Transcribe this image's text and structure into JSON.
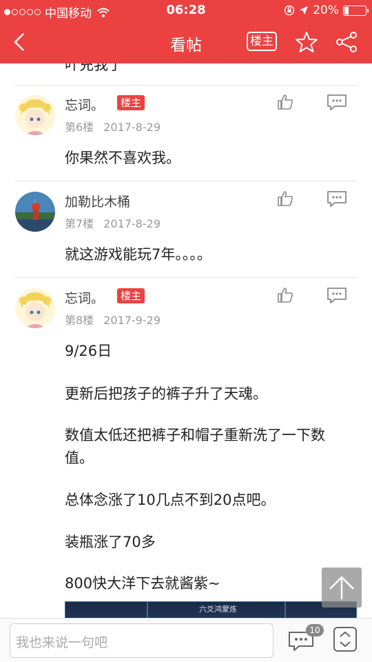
{
  "status_bar": {
    "carrier": "中国移动",
    "time": "06:28",
    "battery_percent": "20%",
    "battery_level": 0.2
  },
  "nav": {
    "title": "看帖",
    "owner_only_label": "楼主"
  },
  "clipped_text": "叶充我了",
  "posts": [
    {
      "username": "忘词。",
      "badge": "楼主",
      "floor": "第6楼",
      "date": "2017-8-29",
      "lines": [
        "你果然不喜欢我。"
      ]
    },
    {
      "username": "加勒比木桶",
      "floor": "第7楼",
      "date": "2017-8-29",
      "lines": [
        "就这游戏能玩7年。。。。"
      ]
    },
    {
      "username": "忘词。",
      "badge": "楼主",
      "floor": "第8楼",
      "date": "2017-9-29",
      "lines": [
        "9/26日",
        "更新后把孩子的裤子升了天魂。",
        "数值太低还把裤子和帽子重新洗了一下数",
        "值。",
        "总体念涨了10几点不到20点吧。",
        "装瓶涨了70多",
        "800快大洋下去就酱紫~"
      ],
      "image_caption": "六爻鸿蒙炼"
    }
  ],
  "bottom_bar": {
    "input_placeholder": "我也来说一句吧",
    "comment_count": "10"
  },
  "colors": {
    "brand_red": "#ec4141",
    "badge_red": "#ec4141"
  }
}
